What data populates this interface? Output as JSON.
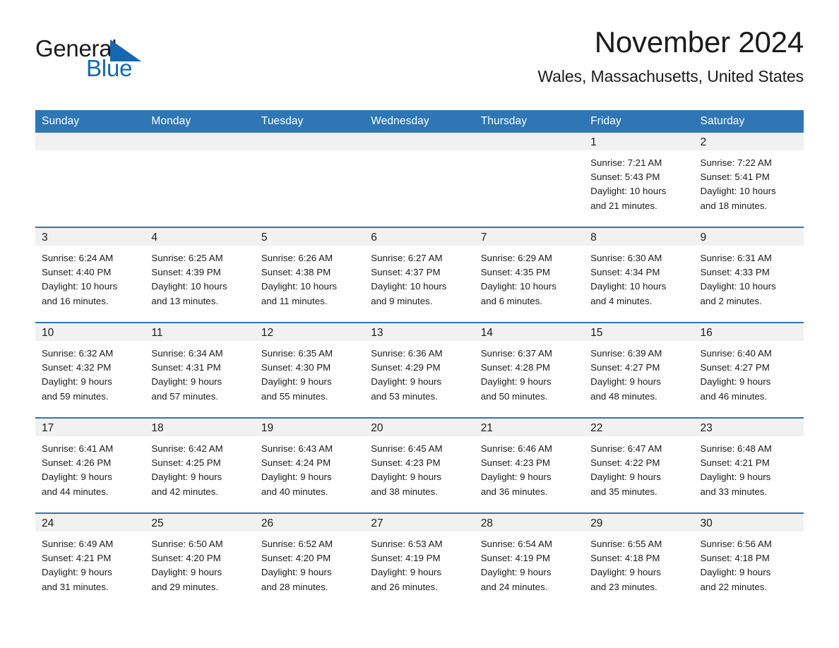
{
  "brand": {
    "name_part1": "General",
    "name_part2": "Blue",
    "accent_color": "#1568b0",
    "triangle_icon": "triangle-right-icon"
  },
  "header": {
    "month_title": "November 2024",
    "location": "Wales, Massachusetts, United States"
  },
  "calendar": {
    "header_bg": "#2f76b4",
    "daynum_bg": "#f1f1f1",
    "weekdays": [
      "Sunday",
      "Monday",
      "Tuesday",
      "Wednesday",
      "Thursday",
      "Friday",
      "Saturday"
    ],
    "weeks": [
      [
        {
          "day": "",
          "sunrise": "",
          "sunset": "",
          "daylight_line1": "",
          "daylight_line2": ""
        },
        {
          "day": "",
          "sunrise": "",
          "sunset": "",
          "daylight_line1": "",
          "daylight_line2": ""
        },
        {
          "day": "",
          "sunrise": "",
          "sunset": "",
          "daylight_line1": "",
          "daylight_line2": ""
        },
        {
          "day": "",
          "sunrise": "",
          "sunset": "",
          "daylight_line1": "",
          "daylight_line2": ""
        },
        {
          "day": "",
          "sunrise": "",
          "sunset": "",
          "daylight_line1": "",
          "daylight_line2": ""
        },
        {
          "day": "1",
          "sunrise": "Sunrise: 7:21 AM",
          "sunset": "Sunset: 5:43 PM",
          "daylight_line1": "Daylight: 10 hours",
          "daylight_line2": "and 21 minutes."
        },
        {
          "day": "2",
          "sunrise": "Sunrise: 7:22 AM",
          "sunset": "Sunset: 5:41 PM",
          "daylight_line1": "Daylight: 10 hours",
          "daylight_line2": "and 18 minutes."
        }
      ],
      [
        {
          "day": "3",
          "sunrise": "Sunrise: 6:24 AM",
          "sunset": "Sunset: 4:40 PM",
          "daylight_line1": "Daylight: 10 hours",
          "daylight_line2": "and 16 minutes."
        },
        {
          "day": "4",
          "sunrise": "Sunrise: 6:25 AM",
          "sunset": "Sunset: 4:39 PM",
          "daylight_line1": "Daylight: 10 hours",
          "daylight_line2": "and 13 minutes."
        },
        {
          "day": "5",
          "sunrise": "Sunrise: 6:26 AM",
          "sunset": "Sunset: 4:38 PM",
          "daylight_line1": "Daylight: 10 hours",
          "daylight_line2": "and 11 minutes."
        },
        {
          "day": "6",
          "sunrise": "Sunrise: 6:27 AM",
          "sunset": "Sunset: 4:37 PM",
          "daylight_line1": "Daylight: 10 hours",
          "daylight_line2": "and 9 minutes."
        },
        {
          "day": "7",
          "sunrise": "Sunrise: 6:29 AM",
          "sunset": "Sunset: 4:35 PM",
          "daylight_line1": "Daylight: 10 hours",
          "daylight_line2": "and 6 minutes."
        },
        {
          "day": "8",
          "sunrise": "Sunrise: 6:30 AM",
          "sunset": "Sunset: 4:34 PM",
          "daylight_line1": "Daylight: 10 hours",
          "daylight_line2": "and 4 minutes."
        },
        {
          "day": "9",
          "sunrise": "Sunrise: 6:31 AM",
          "sunset": "Sunset: 4:33 PM",
          "daylight_line1": "Daylight: 10 hours",
          "daylight_line2": "and 2 minutes."
        }
      ],
      [
        {
          "day": "10",
          "sunrise": "Sunrise: 6:32 AM",
          "sunset": "Sunset: 4:32 PM",
          "daylight_line1": "Daylight: 9 hours",
          "daylight_line2": "and 59 minutes."
        },
        {
          "day": "11",
          "sunrise": "Sunrise: 6:34 AM",
          "sunset": "Sunset: 4:31 PM",
          "daylight_line1": "Daylight: 9 hours",
          "daylight_line2": "and 57 minutes."
        },
        {
          "day": "12",
          "sunrise": "Sunrise: 6:35 AM",
          "sunset": "Sunset: 4:30 PM",
          "daylight_line1": "Daylight: 9 hours",
          "daylight_line2": "and 55 minutes."
        },
        {
          "day": "13",
          "sunrise": "Sunrise: 6:36 AM",
          "sunset": "Sunset: 4:29 PM",
          "daylight_line1": "Daylight: 9 hours",
          "daylight_line2": "and 53 minutes."
        },
        {
          "day": "14",
          "sunrise": "Sunrise: 6:37 AM",
          "sunset": "Sunset: 4:28 PM",
          "daylight_line1": "Daylight: 9 hours",
          "daylight_line2": "and 50 minutes."
        },
        {
          "day": "15",
          "sunrise": "Sunrise: 6:39 AM",
          "sunset": "Sunset: 4:27 PM",
          "daylight_line1": "Daylight: 9 hours",
          "daylight_line2": "and 48 minutes."
        },
        {
          "day": "16",
          "sunrise": "Sunrise: 6:40 AM",
          "sunset": "Sunset: 4:27 PM",
          "daylight_line1": "Daylight: 9 hours",
          "daylight_line2": "and 46 minutes."
        }
      ],
      [
        {
          "day": "17",
          "sunrise": "Sunrise: 6:41 AM",
          "sunset": "Sunset: 4:26 PM",
          "daylight_line1": "Daylight: 9 hours",
          "daylight_line2": "and 44 minutes."
        },
        {
          "day": "18",
          "sunrise": "Sunrise: 6:42 AM",
          "sunset": "Sunset: 4:25 PM",
          "daylight_line1": "Daylight: 9 hours",
          "daylight_line2": "and 42 minutes."
        },
        {
          "day": "19",
          "sunrise": "Sunrise: 6:43 AM",
          "sunset": "Sunset: 4:24 PM",
          "daylight_line1": "Daylight: 9 hours",
          "daylight_line2": "and 40 minutes."
        },
        {
          "day": "20",
          "sunrise": "Sunrise: 6:45 AM",
          "sunset": "Sunset: 4:23 PM",
          "daylight_line1": "Daylight: 9 hours",
          "daylight_line2": "and 38 minutes."
        },
        {
          "day": "21",
          "sunrise": "Sunrise: 6:46 AM",
          "sunset": "Sunset: 4:23 PM",
          "daylight_line1": "Daylight: 9 hours",
          "daylight_line2": "and 36 minutes."
        },
        {
          "day": "22",
          "sunrise": "Sunrise: 6:47 AM",
          "sunset": "Sunset: 4:22 PM",
          "daylight_line1": "Daylight: 9 hours",
          "daylight_line2": "and 35 minutes."
        },
        {
          "day": "23",
          "sunrise": "Sunrise: 6:48 AM",
          "sunset": "Sunset: 4:21 PM",
          "daylight_line1": "Daylight: 9 hours",
          "daylight_line2": "and 33 minutes."
        }
      ],
      [
        {
          "day": "24",
          "sunrise": "Sunrise: 6:49 AM",
          "sunset": "Sunset: 4:21 PM",
          "daylight_line1": "Daylight: 9 hours",
          "daylight_line2": "and 31 minutes."
        },
        {
          "day": "25",
          "sunrise": "Sunrise: 6:50 AM",
          "sunset": "Sunset: 4:20 PM",
          "daylight_line1": "Daylight: 9 hours",
          "daylight_line2": "and 29 minutes."
        },
        {
          "day": "26",
          "sunrise": "Sunrise: 6:52 AM",
          "sunset": "Sunset: 4:20 PM",
          "daylight_line1": "Daylight: 9 hours",
          "daylight_line2": "and 28 minutes."
        },
        {
          "day": "27",
          "sunrise": "Sunrise: 6:53 AM",
          "sunset": "Sunset: 4:19 PM",
          "daylight_line1": "Daylight: 9 hours",
          "daylight_line2": "and 26 minutes."
        },
        {
          "day": "28",
          "sunrise": "Sunrise: 6:54 AM",
          "sunset": "Sunset: 4:19 PM",
          "daylight_line1": "Daylight: 9 hours",
          "daylight_line2": "and 24 minutes."
        },
        {
          "day": "29",
          "sunrise": "Sunrise: 6:55 AM",
          "sunset": "Sunset: 4:18 PM",
          "daylight_line1": "Daylight: 9 hours",
          "daylight_line2": "and 23 minutes."
        },
        {
          "day": "30",
          "sunrise": "Sunrise: 6:56 AM",
          "sunset": "Sunset: 4:18 PM",
          "daylight_line1": "Daylight: 9 hours",
          "daylight_line2": "and 22 minutes."
        }
      ]
    ]
  }
}
